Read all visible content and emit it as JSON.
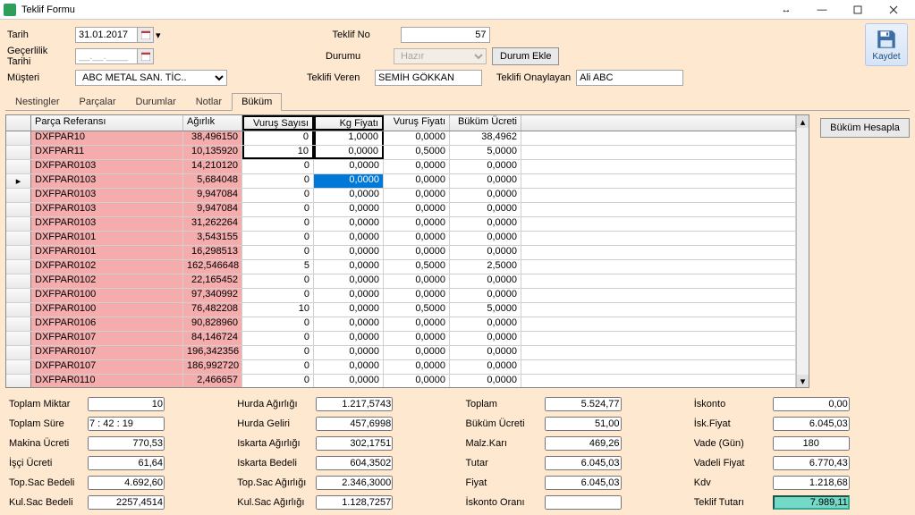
{
  "window": {
    "title": "Teklif Formu"
  },
  "save_button": {
    "label": "Kaydet"
  },
  "form": {
    "tarih_label": "Tarih",
    "tarih_value": "31.01.2017",
    "gecerlilik_label": "Geçerlilik Tarihi",
    "gecerlilik_value": "__.__.____",
    "musteri_label": "Müşteri",
    "musteri_value": "ABC METAL SAN. TİC..",
    "teklifno_label": "Teklif No",
    "teklifno_value": "57",
    "durumu_label": "Durumu",
    "durumu_value": "Hazır",
    "durum_ekle_label": "Durum Ekle",
    "teklifi_veren_label": "Teklifi Veren",
    "teklifi_veren_value": "SEMİH GÖKKAN",
    "teklifi_onaylayan_label": "Teklifi Onaylayan",
    "teklifi_onaylayan_value": "Ali ABC"
  },
  "tabs": {
    "t0": "Nestingler",
    "t1": "Parçalar",
    "t2": "Durumlar",
    "t3": "Notlar",
    "t4": "Büküm"
  },
  "grid": {
    "headers": {
      "ref": "Parça Referansı",
      "wt": "Ağırlık",
      "vs": "Vuruş Sayısı",
      "kg": "Kg Fiyatı",
      "vf": "Vuruş Fiyatı",
      "bu": "Büküm Ücreti"
    },
    "rows": [
      {
        "ref": "DXFPAR10",
        "wt": "38,496150",
        "vs": "0",
        "kg": "1,0000",
        "vf": "0,0000",
        "bu": "38,4962"
      },
      {
        "ref": "DXFPAR11",
        "wt": "10,135920",
        "vs": "10",
        "kg": "0,0000",
        "vf": "0,5000",
        "bu": "5,0000"
      },
      {
        "ref": "DXFPAR0103",
        "wt": "14,210120",
        "vs": "0",
        "kg": "0,0000",
        "vf": "0,0000",
        "bu": "0,0000"
      },
      {
        "ref": "DXFPAR0103",
        "wt": "5,684048",
        "vs": "0",
        "kg": "0,0000",
        "vf": "0,0000",
        "bu": "0,0000",
        "current": true
      },
      {
        "ref": "DXFPAR0103",
        "wt": "9,947084",
        "vs": "0",
        "kg": "0,0000",
        "vf": "0,0000",
        "bu": "0,0000"
      },
      {
        "ref": "DXFPAR0103",
        "wt": "9,947084",
        "vs": "0",
        "kg": "0,0000",
        "vf": "0,0000",
        "bu": "0,0000"
      },
      {
        "ref": "DXFPAR0103",
        "wt": "31,262264",
        "vs": "0",
        "kg": "0,0000",
        "vf": "0,0000",
        "bu": "0,0000"
      },
      {
        "ref": "DXFPAR0101",
        "wt": "3,543155",
        "vs": "0",
        "kg": "0,0000",
        "vf": "0,0000",
        "bu": "0,0000"
      },
      {
        "ref": "DXFPAR0101",
        "wt": "16,298513",
        "vs": "0",
        "kg": "0,0000",
        "vf": "0,0000",
        "bu": "0,0000"
      },
      {
        "ref": "DXFPAR0102",
        "wt": "162,546648",
        "vs": "5",
        "kg": "0,0000",
        "vf": "0,5000",
        "bu": "2,5000"
      },
      {
        "ref": "DXFPAR0102",
        "wt": "22,165452",
        "vs": "0",
        "kg": "0,0000",
        "vf": "0,0000",
        "bu": "0,0000"
      },
      {
        "ref": "DXFPAR0100",
        "wt": "97,340992",
        "vs": "0",
        "kg": "0,0000",
        "vf": "0,0000",
        "bu": "0,0000"
      },
      {
        "ref": "DXFPAR0100",
        "wt": "76,482208",
        "vs": "10",
        "kg": "0,0000",
        "vf": "0,5000",
        "bu": "5,0000"
      },
      {
        "ref": "DXFPAR0106",
        "wt": "90,828960",
        "vs": "0",
        "kg": "0,0000",
        "vf": "0,0000",
        "bu": "0,0000"
      },
      {
        "ref": "DXFPAR0107",
        "wt": "84,146724",
        "vs": "0",
        "kg": "0,0000",
        "vf": "0,0000",
        "bu": "0,0000"
      },
      {
        "ref": "DXFPAR0107",
        "wt": "196,342356",
        "vs": "0",
        "kg": "0,0000",
        "vf": "0,0000",
        "bu": "0,0000"
      },
      {
        "ref": "DXFPAR0107",
        "wt": "186,992720",
        "vs": "0",
        "kg": "0,0000",
        "vf": "0,0000",
        "bu": "0,0000"
      },
      {
        "ref": "DXFPAR0110",
        "wt": "2,466657",
        "vs": "0",
        "kg": "0,0000",
        "vf": "0,0000",
        "bu": "0,0000"
      }
    ]
  },
  "side": {
    "bukum_hesapla": "Büküm Hesapla"
  },
  "summary": {
    "toplam_miktar_label": "Toplam Miktar",
    "toplam_miktar": "10",
    "toplam_sure_label": "Toplam Süre",
    "toplam_sure": "7 : 42 : 19",
    "makina_label": "Makina Ücreti",
    "makina": "770,53",
    "isci_label": "İşçi Ücreti",
    "isci": "61,64",
    "topsac_bedeli_label": "Top.Sac Bedeli",
    "topsac_bedeli": "4.692,60",
    "kulsac_bedeli_label": "Kul.Sac Bedeli",
    "kulsac_bedeli": "2257,4514",
    "hurda_agirligi_label": "Hurda Ağırlığı",
    "hurda_agirligi": "1.217,5743",
    "hurda_geliri_label": "Hurda Geliri",
    "hurda_geliri": "457,6998",
    "iskarta_agirligi_label": "Iskarta Ağırlığı",
    "iskarta_agirligi": "302,1751",
    "iskarta_bedeli_label": "Iskarta Bedeli",
    "iskarta_bedeli": "604,3502",
    "topsac_agirligi_label": "Top.Sac Ağırlığı",
    "topsac_agirligi": "2.346,3000",
    "kulsac_agirligi_label": "Kul.Sac Ağırlığı",
    "kulsac_agirligi": "1.128,7257",
    "toplam_label": "Toplam",
    "toplam": "5.524,77",
    "bukum_ucreti_label": "Büküm Ücreti",
    "bukum_ucreti": "51,00",
    "malz_label": "Malz.Karı",
    "malz": "469,26",
    "tutar_label": "Tutar",
    "tutar": "6.045,03",
    "fiyat_label": "Fiyat",
    "fiyat": "6.045,03",
    "iskonto_orani_label": "İskonto Oranı",
    "iskonto_label": "İskonto",
    "iskonto": "0,00",
    "isk_fiyat_label": "İsk.Fiyat",
    "isk_fiyat": "6.045,03",
    "vade_label": "Vade (Gün)",
    "vade": "180",
    "vadeli_fiyat_label": "Vadeli Fiyat",
    "vadeli_fiyat": "6.770,43",
    "kdv_label": "Kdv",
    "kdv": "1.218,68",
    "teklif_tutari_label": "Teklif Tutarı",
    "teklif_tutari": "7.989,11"
  }
}
